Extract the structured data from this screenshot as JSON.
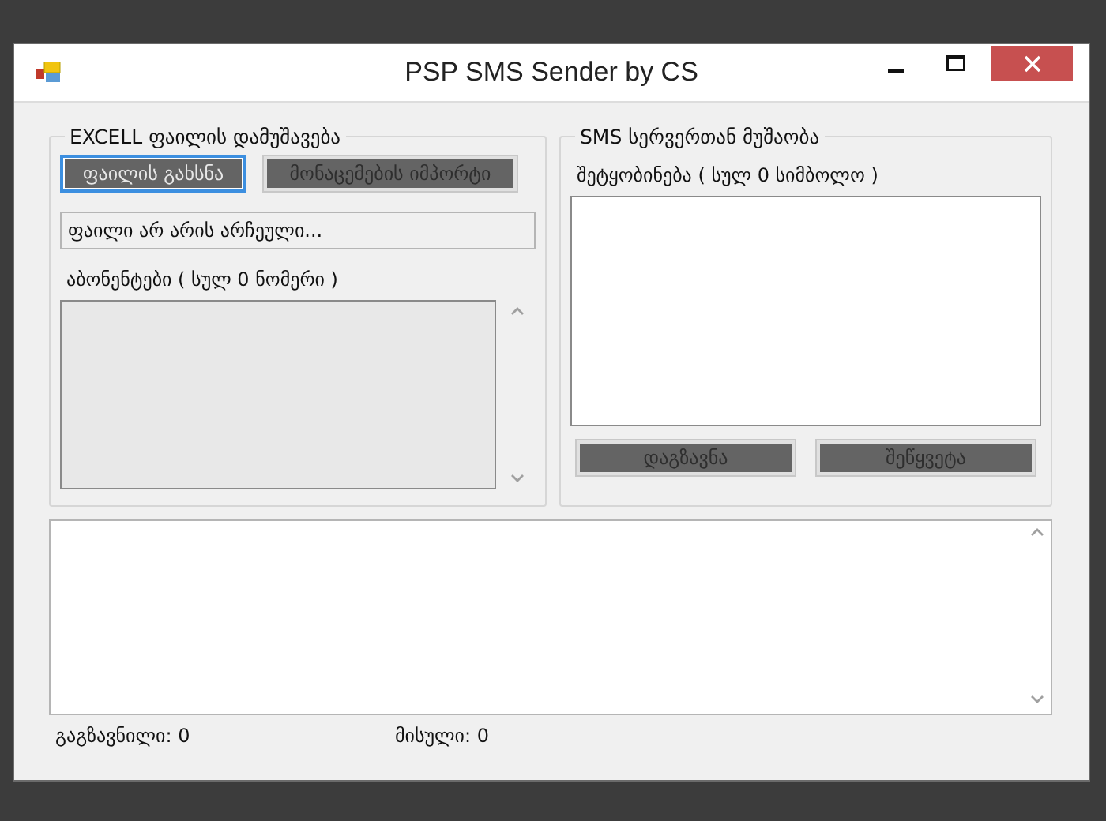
{
  "window": {
    "title": "PSP SMS Sender by CS"
  },
  "excel_group": {
    "title": "EXCELL ფაილის დამუშავება",
    "buttons": [
      {
        "label": "ფაილის გახსნა",
        "disabled": false,
        "focused": true
      },
      {
        "label": "მონაცემების იმპორტი",
        "disabled": true,
        "focused": false
      }
    ],
    "file_status": "ფაილი არ არის არჩეული...",
    "subscribers_label": "აბონენტები ( სულ 0 ნომერი )"
  },
  "sms_group": {
    "title": "SMS სერვერთან მუშაობა",
    "message_label": "შეტყობინება ( სულ 0 სიმბოლო )",
    "buttons": [
      {
        "label": "დაგზავნა",
        "disabled": true,
        "focused": false
      },
      {
        "label": "შეწყვეტა",
        "disabled": true,
        "focused": false
      }
    ]
  },
  "status_bar": [
    {
      "label": "გაგზავნილი: 0"
    },
    {
      "label": "მისული: 0"
    }
  ]
}
